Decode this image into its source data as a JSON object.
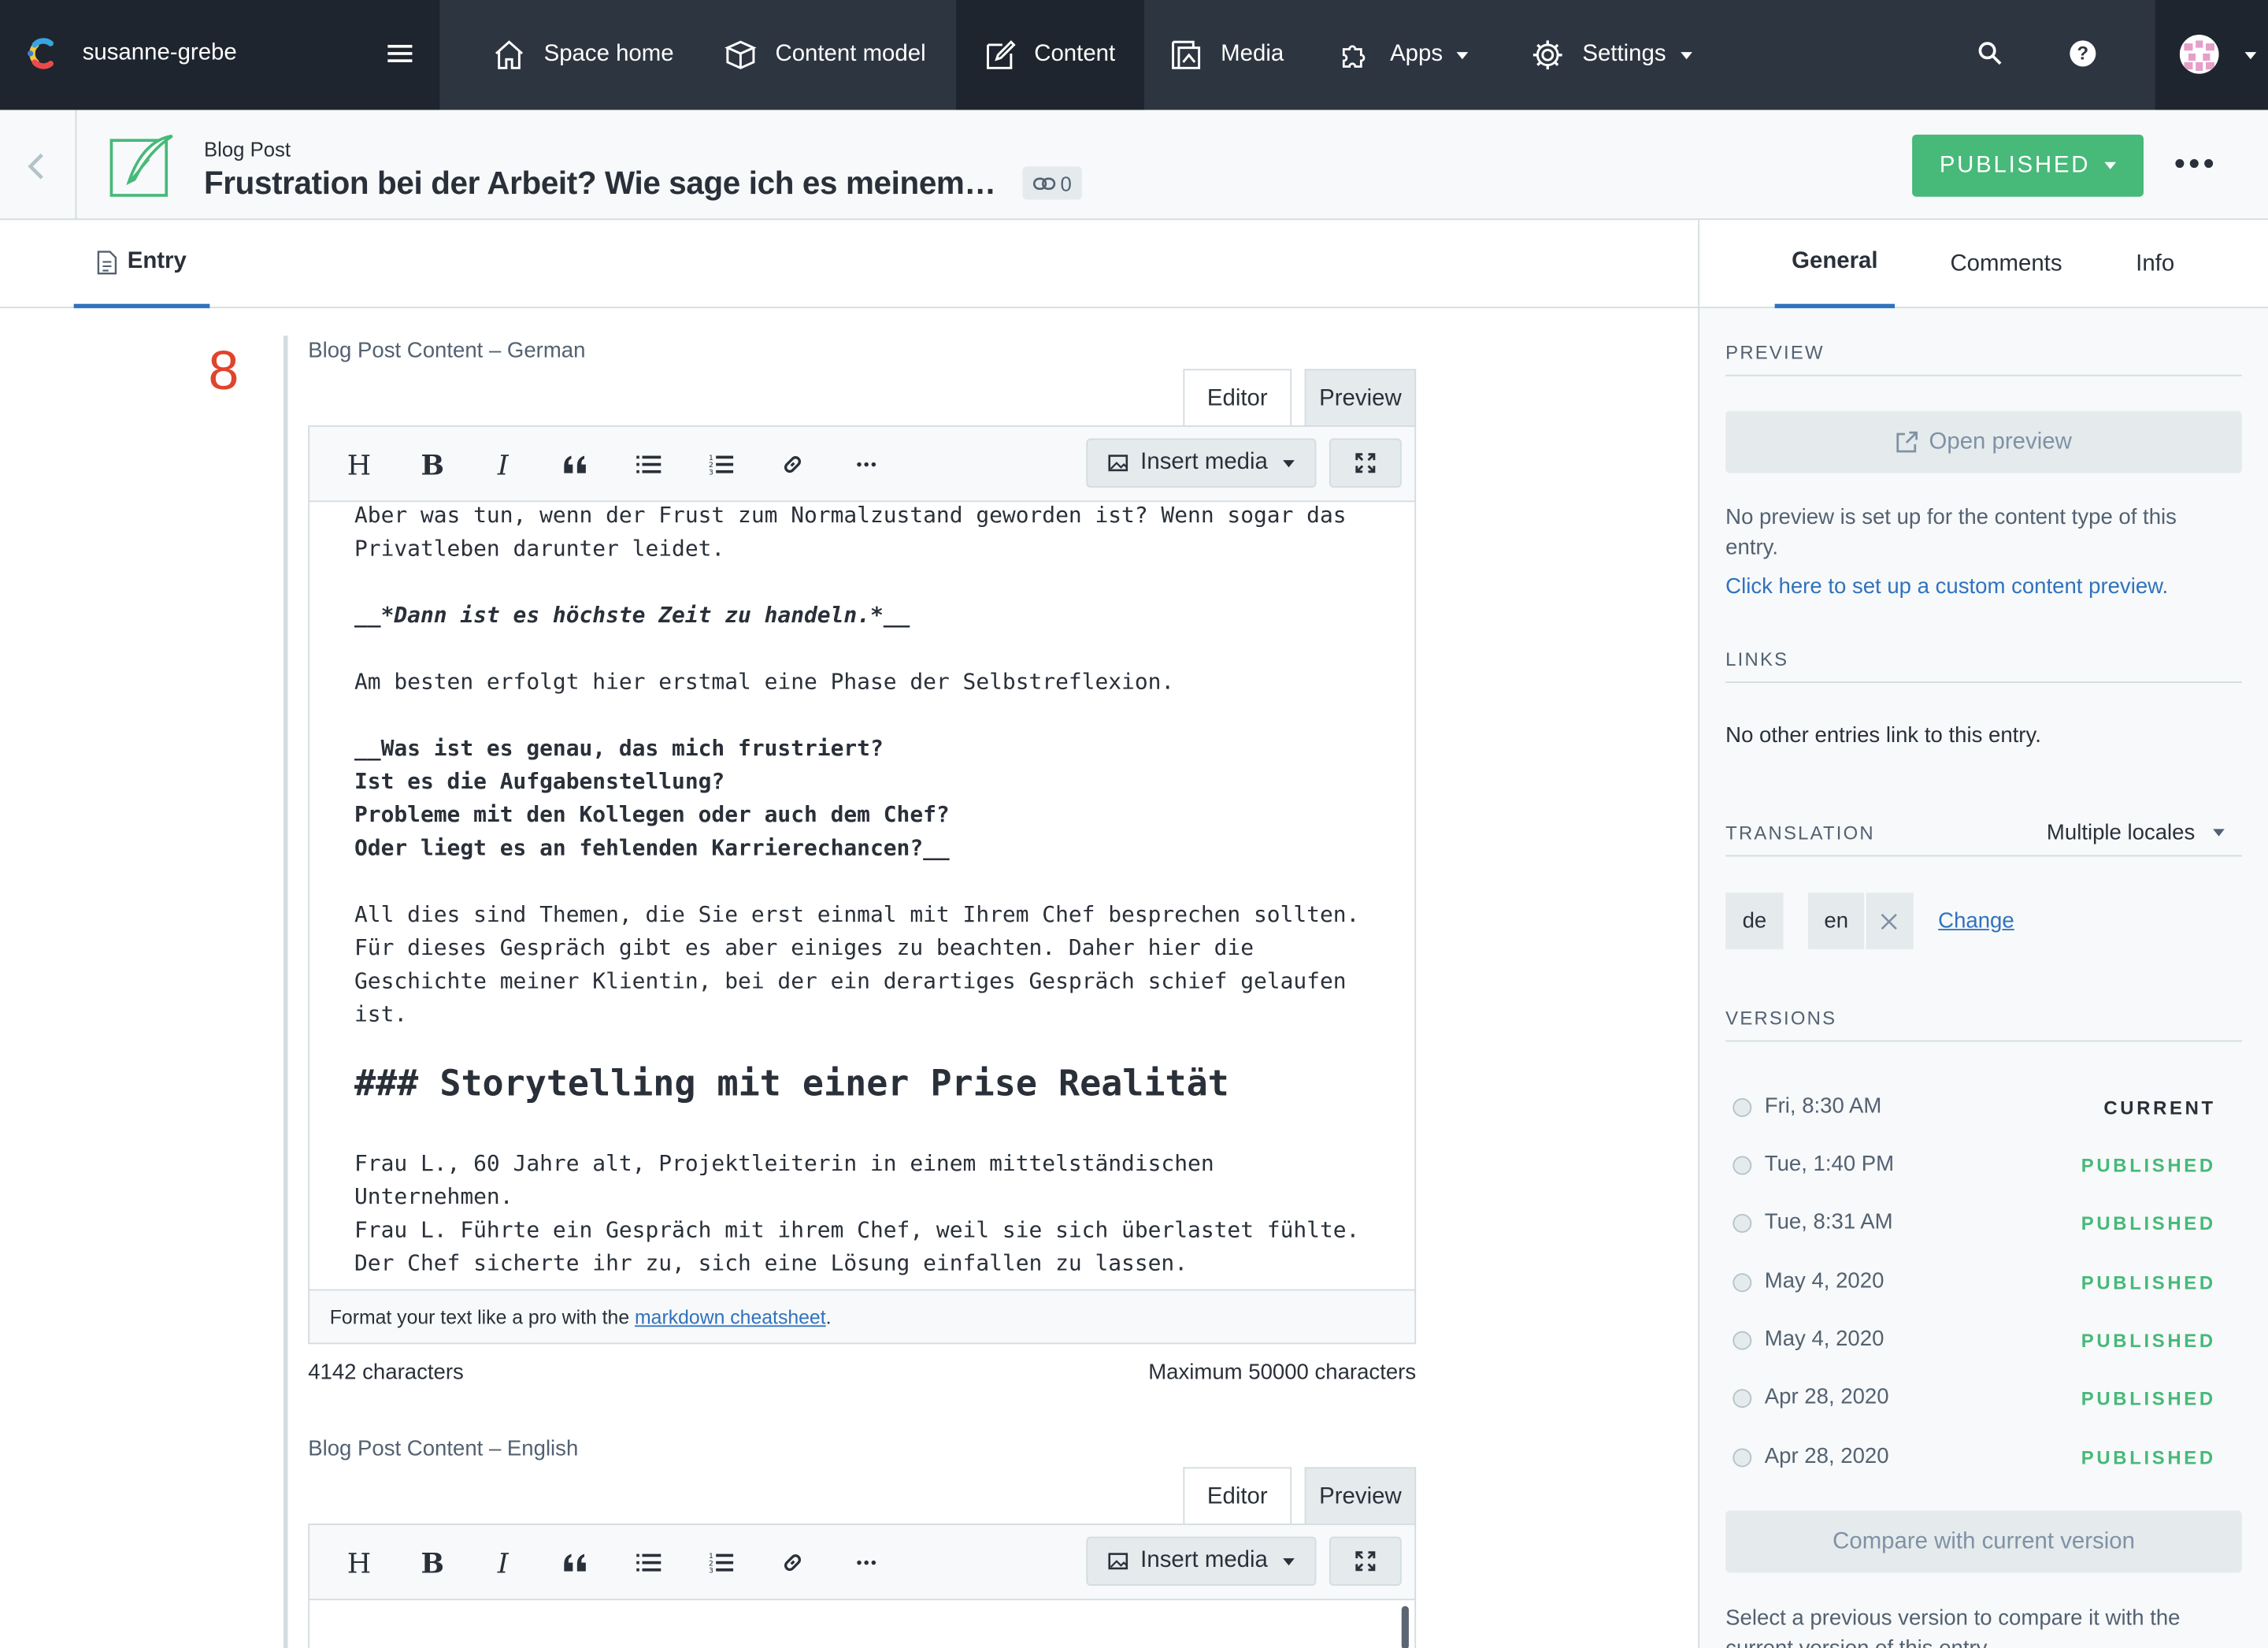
{
  "topnav": {
    "space_name": "susanne-grebe",
    "items": [
      {
        "label": "Space home",
        "icon": "home-icon"
      },
      {
        "label": "Content model",
        "icon": "content-model-icon"
      },
      {
        "label": "Content",
        "icon": "content-icon"
      },
      {
        "label": "Media",
        "icon": "media-icon"
      },
      {
        "label": "Apps",
        "icon": "apps-icon"
      },
      {
        "label": "Settings",
        "icon": "gear-icon"
      }
    ],
    "help": "?"
  },
  "entry": {
    "content_type": "Blog Post",
    "title": "Frustration bei der Arbeit? Wie sage ich es meinem…",
    "references_count": "0",
    "status_button": "PUBLISHED"
  },
  "tabs": {
    "entry": "Entry"
  },
  "field": {
    "number": "8"
  },
  "editor1": {
    "label": "Blog Post Content – German",
    "mode_editor": "Editor",
    "mode_preview": "Preview",
    "insert_media": "Insert media",
    "toolbar": {
      "heading": "H",
      "bold": "B",
      "italic": "I"
    },
    "lines": [
      "Aber was tun, wenn der Frust zum Normalzustand geworden ist? Wenn sogar das",
      "Privatleben darunter leidet.",
      "__*Dann ist es höchste Zeit zu handeln.*__",
      "Am besten erfolgt hier erstmal eine Phase der Selbstreflexion.",
      "__Was ist es genau, das mich frustriert?",
      "Ist es die Aufgabenstellung?",
      "Probleme mit den Kollegen oder auch dem Chef?",
      "Oder liegt es an fehlenden Karrierechancen?__",
      "All dies sind Themen, die Sie erst einmal mit Ihrem Chef besprechen sollten.",
      "Für dieses Gespräch gibt es aber einiges zu beachten. Daher hier die",
      "Geschichte meiner Klientin, bei der ein derartiges Gespräch schief gelaufen",
      "ist.",
      "### Storytelling mit einer Prise Realität",
      "Frau L., 60 Jahre alt, Projektleiterin in einem mittelständischen",
      "Unternehmen.",
      "Frau L. Führte ein Gespräch mit ihrem Chef, weil sie sich überlastet fühlte.",
      "Der Chef sicherte ihr zu, sich eine Lösung einfallen zu lassen."
    ],
    "footer_text": "Format your text like a pro with the ",
    "footer_link": "markdown cheatsheet",
    "footer_end": ".",
    "char_count": "4142 characters",
    "max_chars": "Maximum 50000 characters"
  },
  "editor2": {
    "label": "Blog Post Content – English",
    "mode_editor": "Editor",
    "mode_preview": "Preview",
    "insert_media": "Insert media",
    "toolbar": {
      "heading": "H",
      "bold": "B",
      "italic": "I"
    }
  },
  "sidebar": {
    "tabs": [
      "General",
      "Comments",
      "Info"
    ],
    "preview": {
      "heading": "PREVIEW",
      "button": "Open preview",
      "note": "No preview is set up for the content type of this entry.",
      "link": "Click here to set up a custom content preview."
    },
    "links": {
      "heading": "LINKS",
      "note": "No other entries link to this entry."
    },
    "translation": {
      "heading": "TRANSLATION",
      "select": "Multiple locales",
      "locales": [
        "de",
        "en"
      ],
      "change": "Change"
    },
    "versions": {
      "heading": "VERSIONS",
      "items": [
        {
          "date": "Fri, 8:30 AM",
          "status": "CURRENT"
        },
        {
          "date": "Tue, 1:40 PM",
          "status": "PUBLISHED"
        },
        {
          "date": "Tue, 8:31 AM",
          "status": "PUBLISHED"
        },
        {
          "date": "May 4, 2020",
          "status": "PUBLISHED"
        },
        {
          "date": "May 4, 2020",
          "status": "PUBLISHED"
        },
        {
          "date": "Apr 28, 2020",
          "status": "PUBLISHED"
        },
        {
          "date": "Apr 28, 2020",
          "status": "PUBLISHED"
        }
      ],
      "compare_button": "Compare with current version",
      "compare_note": "Select a previous version to compare it with the current version of this entry."
    }
  },
  "colors": {
    "nav_bg": "#2d3540",
    "nav_active": "#1e252e",
    "published": "#47b979",
    "link": "#3072be",
    "field_number": "#e0442c"
  }
}
